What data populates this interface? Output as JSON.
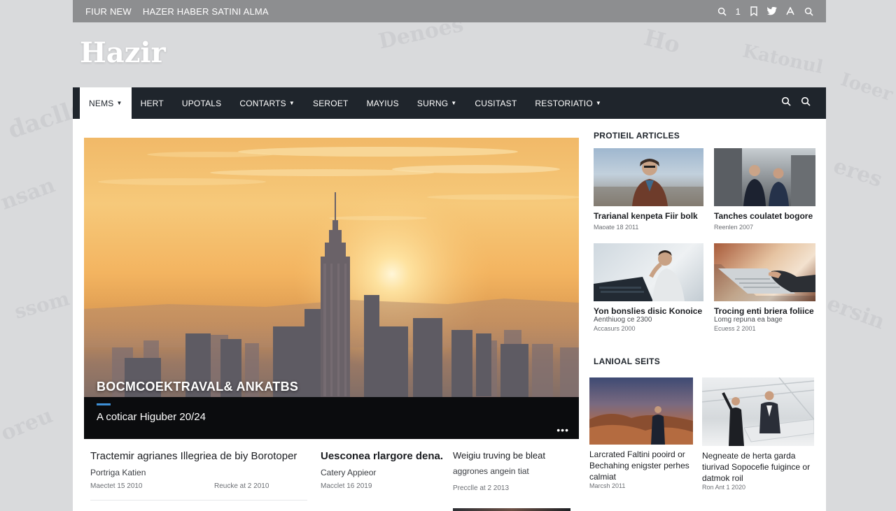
{
  "topbar": {
    "links": [
      "FIUR NEW",
      "HAZER HABER SATINI ALMA"
    ],
    "count": "1"
  },
  "logo": "Hazir",
  "nav": {
    "items": [
      {
        "label": "NEMS",
        "caret": true,
        "active": true
      },
      {
        "label": "HERT",
        "caret": false
      },
      {
        "label": "UPOTALS",
        "caret": false
      },
      {
        "label": "CONTARTS",
        "caret": true
      },
      {
        "label": "SEROET",
        "caret": false
      },
      {
        "label": "MAYIUS",
        "caret": false
      },
      {
        "label": "SURNG",
        "caret": true
      },
      {
        "label": "CUSITAST",
        "caret": false
      },
      {
        "label": "RESTORIATIO",
        "caret": true
      }
    ]
  },
  "hero": {
    "title": "BOCMCOEKTRAVAL& ANKATBS",
    "subtitle": "A coticar Higuber 20/24",
    "more": "•••"
  },
  "stories": [
    {
      "title": "Tractemir agrianes Illegriea de biy Borotoper",
      "category": "Portriga Katien",
      "meta": [
        "Maectet 15 2010",
        "Reucke at 2 2010"
      ]
    },
    {
      "title": "Uesconea rlargore dena.",
      "category": "Catery Appieor",
      "meta": [
        "Macclet 16 2019"
      ]
    },
    {
      "title": "Weigiu truving be bleat",
      "category": "aggrones angein tiat",
      "meta": [
        "Precclle at 2 2013"
      ]
    }
  ],
  "sidebar": {
    "section1": "PROTIEIL ARTICLES",
    "cards": [
      {
        "title": "Trarianal kenpeta Fiir bolk",
        "meta": "Maoate 18 2011"
      },
      {
        "title": "Tanches coulatet bogore",
        "meta": "Reenlen 2007"
      },
      {
        "title": "Yon bonslies disic Konoice",
        "sub": "Aenthiuog ce 2300",
        "meta": "Accasurs 2000"
      },
      {
        "title": "Trocing enti briera foliice",
        "sub": "Lomg repuna ea bage",
        "meta": "Ecuess 2 2001"
      }
    ],
    "section2": "LANIOAL SEITS",
    "big": [
      {
        "title": "Larcrated Faltini pooird or Bechahing enigster perhes calmiat",
        "meta": "Marcsh 2011"
      },
      {
        "title": "Negneate de herta garda tiurivad Sopocefie fuigince or datmok roil",
        "meta": "Ron Ant 1 2020"
      }
    ]
  },
  "colors": {
    "nav_bg": "#1f252c",
    "topbar_bg": "#8d8e90",
    "accent": "#3e8fd6"
  }
}
